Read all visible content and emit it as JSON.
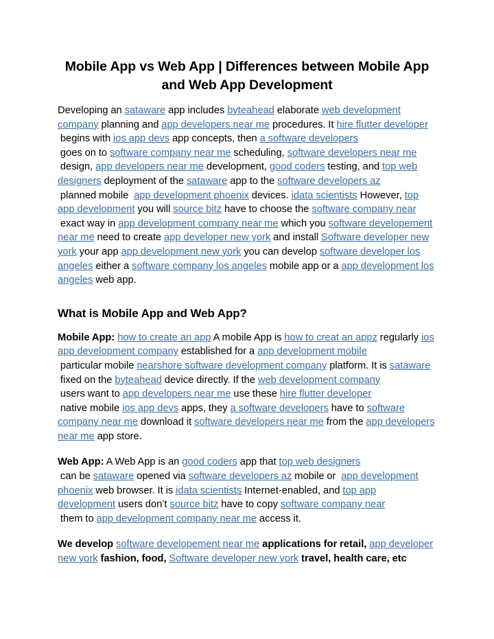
{
  "document": {
    "title": "Mobile App vs Web App | Differences between Mobile App and Web App Development",
    "link_color": "#3a6ea5",
    "text_color": "#000000",
    "background_color": "#ffffff"
  },
  "headings": {
    "section_1": "What is Mobile App and Web App?"
  },
  "labels": {
    "mobile_app": "Mobile App:",
    "web_app": "Web App:"
  },
  "paragraphs": {
    "intro": [
      {
        "t": "text",
        "s": "Developing an "
      },
      {
        "t": "link",
        "s": "sataware"
      },
      {
        "t": "text",
        "s": " app includes "
      },
      {
        "t": "link",
        "s": "byteahead"
      },
      {
        "t": "text",
        "s": " elaborate "
      },
      {
        "t": "link",
        "s": "web development company"
      },
      {
        "t": "text",
        "s": " planning and "
      },
      {
        "t": "link",
        "s": "app developers near me"
      },
      {
        "t": "text",
        "s": " procedures. It "
      },
      {
        "t": "link",
        "s": "hire flutter developer"
      },
      {
        "t": "text",
        "s": " begins with "
      },
      {
        "t": "link",
        "s": "ios app devs"
      },
      {
        "t": "text",
        "s": " app concepts, then "
      },
      {
        "t": "link",
        "s": "a software developers"
      },
      {
        "t": "text",
        "s": " goes on to "
      },
      {
        "t": "link",
        "s": "software company near me"
      },
      {
        "t": "text",
        "s": " scheduling, "
      },
      {
        "t": "link",
        "s": "software developers near me"
      },
      {
        "t": "text",
        "s": " design, "
      },
      {
        "t": "link",
        "s": "app developers near me"
      },
      {
        "t": "text",
        "s": " development, "
      },
      {
        "t": "link",
        "s": "good coders"
      },
      {
        "t": "text",
        "s": " testing, and "
      },
      {
        "t": "link",
        "s": "top web designers"
      },
      {
        "t": "text",
        "s": " deployment of the "
      },
      {
        "t": "link",
        "s": "sataware"
      },
      {
        "t": "text",
        "s": " app to the "
      },
      {
        "t": "link",
        "s": "software developers az"
      },
      {
        "t": "text",
        "s": " planned mobile  "
      },
      {
        "t": "link",
        "s": "app development phoenix"
      },
      {
        "t": "text",
        "s": " devices. "
      },
      {
        "t": "link",
        "s": "idata scientists"
      },
      {
        "t": "text",
        "s": " However, "
      },
      {
        "t": "link",
        "s": "top app development"
      },
      {
        "t": "text",
        "s": " you will "
      },
      {
        "t": "link",
        "s": "source bitz"
      },
      {
        "t": "text",
        "s": " have to choose the "
      },
      {
        "t": "link",
        "s": "software company near"
      },
      {
        "t": "text",
        "s": " exact way in "
      },
      {
        "t": "link",
        "s": "app development company near me"
      },
      {
        "t": "text",
        "s": " which you "
      },
      {
        "t": "link",
        "s": "software developement near me"
      },
      {
        "t": "text",
        "s": " need to create "
      },
      {
        "t": "link",
        "s": "app developer new york"
      },
      {
        "t": "text",
        "s": " and install "
      },
      {
        "t": "link",
        "s": "Software developer new york"
      },
      {
        "t": "text",
        "s": " your app "
      },
      {
        "t": "link",
        "s": "app development new york"
      },
      {
        "t": "text",
        "s": " you can develop "
      },
      {
        "t": "link",
        "s": "software developer los angeles"
      },
      {
        "t": "text",
        "s": " either a "
      },
      {
        "t": "link",
        "s": "software company los angeles"
      },
      {
        "t": "text",
        "s": " mobile app or a "
      },
      {
        "t": "link",
        "s": "app development los angeles"
      },
      {
        "t": "text",
        "s": " web app."
      }
    ],
    "mobile_app": [
      {
        "t": "text",
        "s": " "
      },
      {
        "t": "link",
        "s": "how to create an app"
      },
      {
        "t": "text",
        "s": " A mobile App is "
      },
      {
        "t": "link",
        "s": "how to creat an appz"
      },
      {
        "t": "text",
        "s": " regularly "
      },
      {
        "t": "link",
        "s": "ios app development company"
      },
      {
        "t": "text",
        "s": " established for a "
      },
      {
        "t": "link",
        "s": "app development mobile"
      },
      {
        "t": "text",
        "s": " particular mobile "
      },
      {
        "t": "link",
        "s": "nearshore software development company"
      },
      {
        "t": "text",
        "s": " platform. It is "
      },
      {
        "t": "link",
        "s": "sataware"
      },
      {
        "t": "text",
        "s": " fixed on the "
      },
      {
        "t": "link",
        "s": "byteahead"
      },
      {
        "t": "text",
        "s": " device directly. If the "
      },
      {
        "t": "link",
        "s": "web development company"
      },
      {
        "t": "text",
        "s": " users want to "
      },
      {
        "t": "link",
        "s": "app developers near me"
      },
      {
        "t": "text",
        "s": " use these "
      },
      {
        "t": "link",
        "s": "hire flutter developer"
      },
      {
        "t": "text",
        "s": " native mobile "
      },
      {
        "t": "link",
        "s": "ios app devs"
      },
      {
        "t": "text",
        "s": " apps, they "
      },
      {
        "t": "link",
        "s": "a software developers"
      },
      {
        "t": "text",
        "s": " have to "
      },
      {
        "t": "link",
        "s": "software company near me"
      },
      {
        "t": "text",
        "s": " download it "
      },
      {
        "t": "link",
        "s": "software developers near me"
      },
      {
        "t": "text",
        "s": " from the "
      },
      {
        "t": "link",
        "s": "app developers near me"
      },
      {
        "t": "text",
        "s": " app store."
      }
    ],
    "web_app": [
      {
        "t": "text",
        "s": " A Web App is an "
      },
      {
        "t": "link",
        "s": "good coders"
      },
      {
        "t": "text",
        "s": " app that "
      },
      {
        "t": "link",
        "s": "top web designers"
      },
      {
        "t": "text",
        "s": " can be "
      },
      {
        "t": "link",
        "s": "sataware"
      },
      {
        "t": "text",
        "s": " opened via "
      },
      {
        "t": "link",
        "s": "software developers az"
      },
      {
        "t": "text",
        "s": " mobile or  "
      },
      {
        "t": "link",
        "s": "app development phoenix"
      },
      {
        "t": "text",
        "s": " web browser. It is "
      },
      {
        "t": "link",
        "s": "idata scientists"
      },
      {
        "t": "text",
        "s": " Internet-enabled, and "
      },
      {
        "t": "link",
        "s": "top app development"
      },
      {
        "t": "text",
        "s": " users don’t "
      },
      {
        "t": "link",
        "s": "source bitz"
      },
      {
        "t": "text",
        "s": " have to copy "
      },
      {
        "t": "link",
        "s": "software company near"
      },
      {
        "t": "text",
        "s": " them to "
      },
      {
        "t": "link",
        "s": "app development company near me"
      },
      {
        "t": "text",
        "s": " access it."
      }
    ],
    "closing": [
      {
        "t": "text",
        "s": "We develop "
      },
      {
        "t": "link",
        "s": "software developement near me"
      },
      {
        "t": "text",
        "s": " applications for retail, "
      },
      {
        "t": "link",
        "s": "app developer new york"
      },
      {
        "t": "text",
        "s": " fashion, food, "
      },
      {
        "t": "link",
        "s": "Software developer new york"
      },
      {
        "t": "text",
        "s": " travel, health care, etc"
      }
    ]
  }
}
